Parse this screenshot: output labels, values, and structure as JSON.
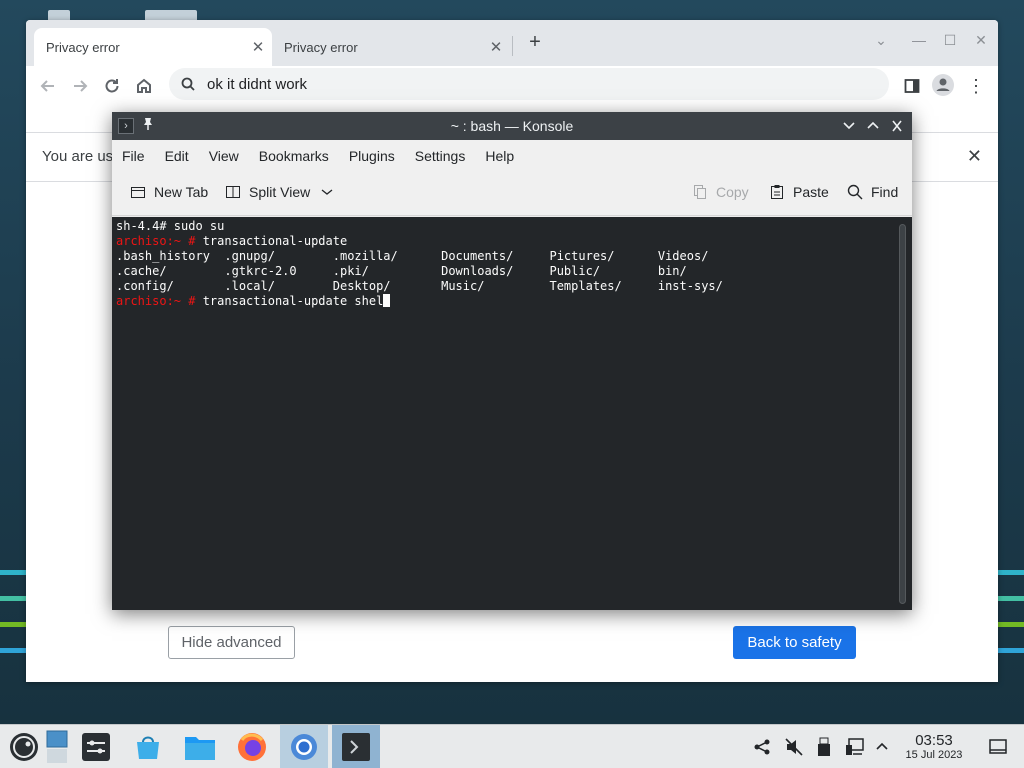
{
  "browser": {
    "tabs": [
      {
        "label": "Privacy error",
        "close": "✕"
      },
      {
        "label": "Privacy error",
        "close": "✕"
      }
    ],
    "new_tab": "+",
    "window_controls": {
      "tab_search": "⌄",
      "minimize": "—",
      "maximize": "☐",
      "close": "✕"
    },
    "nav": {
      "back_icon": "arrow-left-icon",
      "forward_icon": "arrow-right-icon",
      "reload_icon": "reload-icon",
      "home_icon": "home-icon"
    },
    "omnibox": {
      "text": "ok it didnt work"
    },
    "menu": "⋮",
    "infobar": {
      "text": "You are us",
      "close": "✕"
    },
    "buttons": {
      "hide_advanced": "Hide advanced",
      "back_to_safety": "Back to safety"
    },
    "colors": {
      "primary_button": "#1a73e8"
    }
  },
  "konsole": {
    "title": "~ : bash — Konsole",
    "menu": [
      "File",
      "Edit",
      "View",
      "Bookmarks",
      "Plugins",
      "Settings",
      "Help"
    ],
    "toolbar": {
      "new_tab": "New Tab",
      "split_view": "Split View",
      "copy": "Copy",
      "paste": "Paste",
      "find": "Find"
    },
    "terminal": {
      "line1": "sh-4.4# sudo su",
      "prompt": "archiso:~ #",
      "cmd1": " transactional-update",
      "ls_rows": [
        ".bash_history  .gnupg/        .mozilla/      Documents/     Pictures/      Videos/",
        ".cache/        .gtkrc-2.0     .pki/          Downloads/     Public/        bin/",
        ".config/       .local/        Desktop/       Music/         Templates/     inst-sys/"
      ],
      "cmd2": " transactional-update shel"
    },
    "colors": {
      "background": "#232629",
      "prompt": "#ed1515"
    }
  },
  "taskbar": {
    "clock_time": "03:53",
    "clock_date": "15 Jul 2023"
  }
}
